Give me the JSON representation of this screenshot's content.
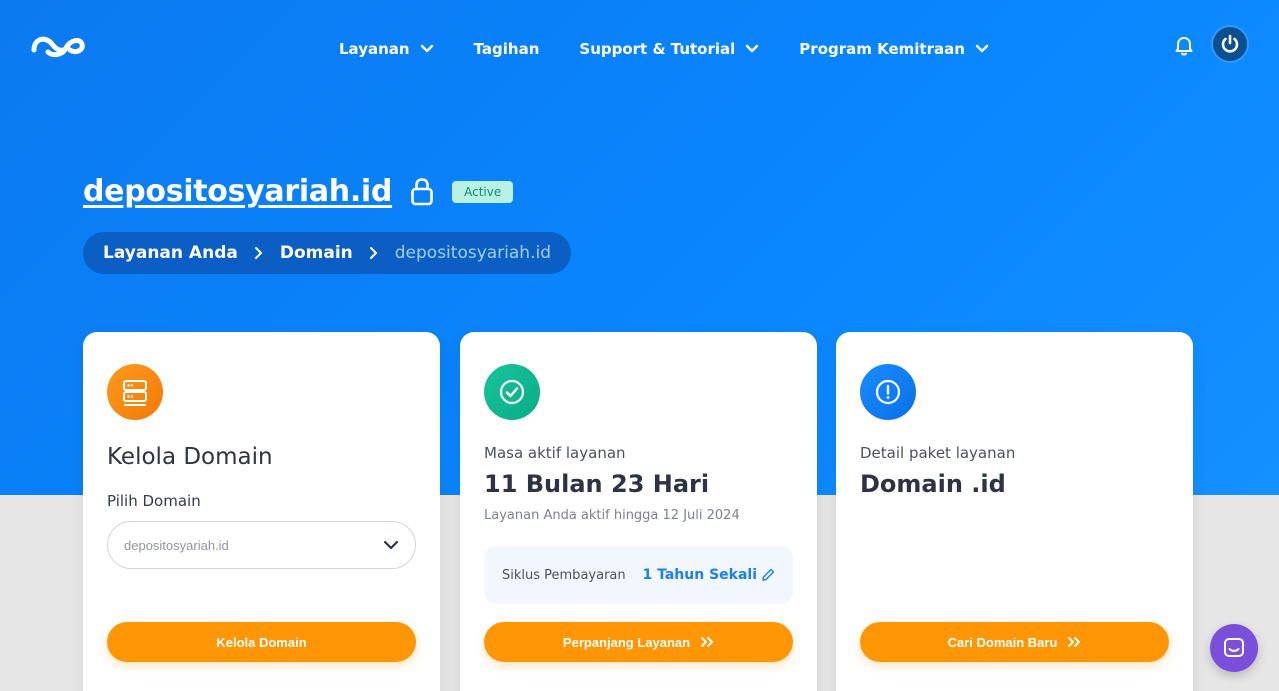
{
  "nav": {
    "items": [
      {
        "label": "Layanan",
        "dropdown": true
      },
      {
        "label": "Tagihan",
        "dropdown": false
      },
      {
        "label": "Support & Tutorial",
        "dropdown": true
      },
      {
        "label": "Program Kemitraan",
        "dropdown": true
      }
    ]
  },
  "header": {
    "domain_title": "depositosyariah.id",
    "status_badge": "Active"
  },
  "breadcrumb": {
    "items": [
      "Layanan Anda",
      "Domain",
      "depositosyariah.id"
    ]
  },
  "cards": {
    "manage": {
      "title": "Kelola Domain",
      "select_label": "Pilih Domain",
      "select_value": "depositosyariah.id",
      "button": "Kelola Domain"
    },
    "active": {
      "label": "Masa aktif layanan",
      "value": "11 Bulan 23 Hari",
      "subtext": "Layanan Anda aktif hingga 12 Juli 2024",
      "cycle_label": "Siklus Pembayaran",
      "cycle_value": "1 Tahun Sekali",
      "button": "Perpanjang Layanan"
    },
    "detail": {
      "label": "Detail paket layanan",
      "value": "Domain .id",
      "button": "Cari Domain Baru"
    }
  },
  "icons": {
    "logo": "brand-logo-icon",
    "bell": "bell-icon",
    "power": "power-icon",
    "lock": "lock-icon",
    "server": "server-icon",
    "check": "check-circle-icon",
    "info": "exclamation-circle-icon",
    "chat": "chat-icon"
  },
  "colors": {
    "primary": "#0a86ff",
    "accent": "#ff9605",
    "success": "#17c59b",
    "badge_bg": "#b9f0e4",
    "chat": "#7b4fd9"
  }
}
